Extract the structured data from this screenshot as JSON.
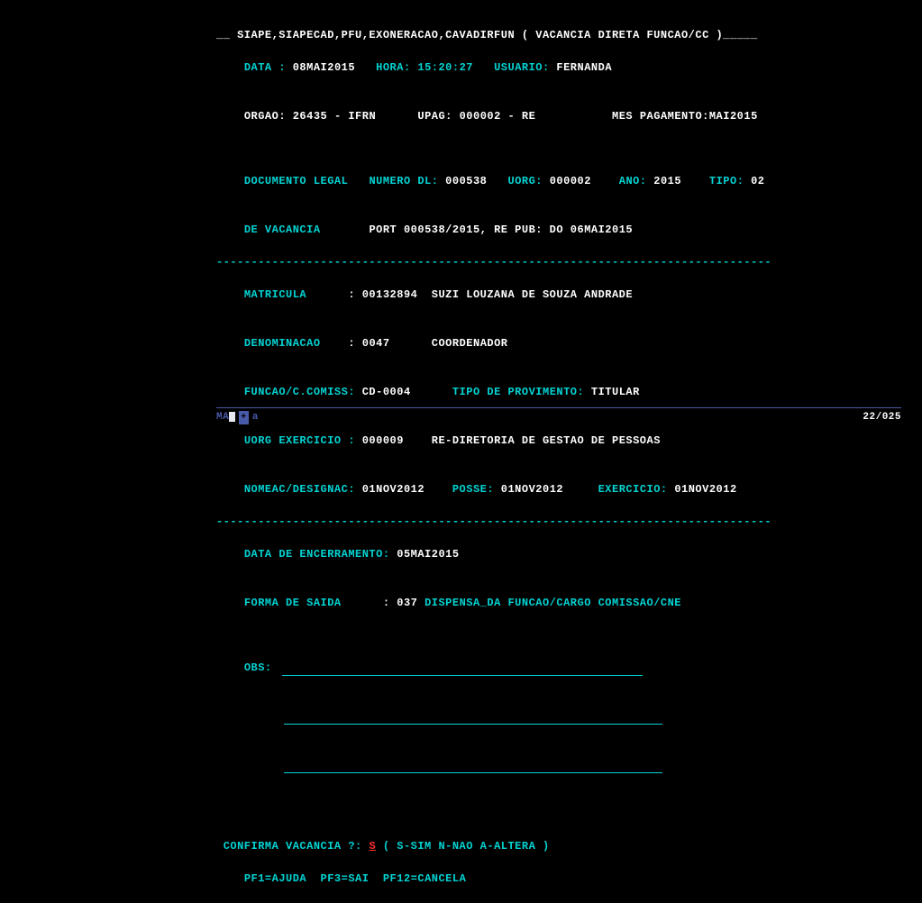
{
  "header": {
    "path": "__ SIAPE,SIAPECAD,PFU,EXONERACAO,CAVADIRFUN ( VACANCIA DIRETA FUNCAO/CC )_____",
    "data_label": "DATA :",
    "data_value": "08MAI2015",
    "hora_label": "HORA:",
    "hora_value": "15:20:27",
    "usuario_label": "USUARIO:",
    "usuario_value": "FERNANDA",
    "orgao_label": "ORGAO:",
    "orgao_value": "26435 - IFRN",
    "upag_label": "UPAG:",
    "upag_value": "000002 - RE",
    "mes_pag_label": "MES PAGAMENTO:",
    "mes_pag_value": "MAI2015"
  },
  "doc": {
    "doc_legal_label": "DOCUMENTO LEGAL",
    "numero_label": "NUMERO DL:",
    "numero_value": "000538",
    "uorg_label": "UORG:",
    "uorg_value": "000002",
    "ano_label": "ANO:",
    "ano_value": "2015",
    "tipo_label": "TIPO:",
    "tipo_value": "02",
    "vac_label": "DE VACANCIA",
    "vac_value": "PORT 000538/2015, RE PUB: DO 06MAI2015"
  },
  "servidor": {
    "matricula_label": "MATRICULA",
    "matricula_num": "00132894",
    "matricula_nome": "SUZI LOUZANA DE SOUZA ANDRADE",
    "denom_label": "DENOMINACAO",
    "denom_code": "0047",
    "denom_desc": "COORDENADOR",
    "funcao_label": "FUNCAO/C.COMISS:",
    "funcao_value": "CD-0004",
    "tipo_prov_label": "TIPO DE PROVIMENTO:",
    "tipo_prov_value": "TITULAR",
    "uorg_ex_label": "UORG EXERCICIO :",
    "uorg_ex_code": "000009",
    "uorg_ex_desc": "RE-DIRETORIA DE GESTAO DE PESSOAS",
    "nomeac_label": "NOMEAC/DESIGNAC:",
    "nomeac_value": "01NOV2012",
    "posse_label": "POSSE:",
    "posse_value": "01NOV2012",
    "exercicio_label": "EXERCICIO:",
    "exercicio_value": "01NOV2012"
  },
  "encerramento": {
    "data_enc_label": "DATA DE ENCERRAMENTO:",
    "data_enc_value": "05MAI2015",
    "forma_label": "FORMA DE SAIDA",
    "forma_code": "037",
    "forma_desc": "DISPENSA_DA FUNCAO/CARGO COMISSAO/CNE"
  },
  "obs_label": "OBS:",
  "confirm": {
    "prompt": "CONFIRMA VACANCIA ?:",
    "answer": "S",
    "options": "( S-SIM N-NAO A-ALTERA )"
  },
  "pfkeys": {
    "pf1": "PF1=AJUDA",
    "pf3": "PF3=SAI",
    "pf12": "PF12=CANCELA"
  },
  "status": {
    "left_ma": "MA",
    "left_a": "a",
    "right": "22/025"
  },
  "divider": "--------------------------------------------------------------------------------"
}
